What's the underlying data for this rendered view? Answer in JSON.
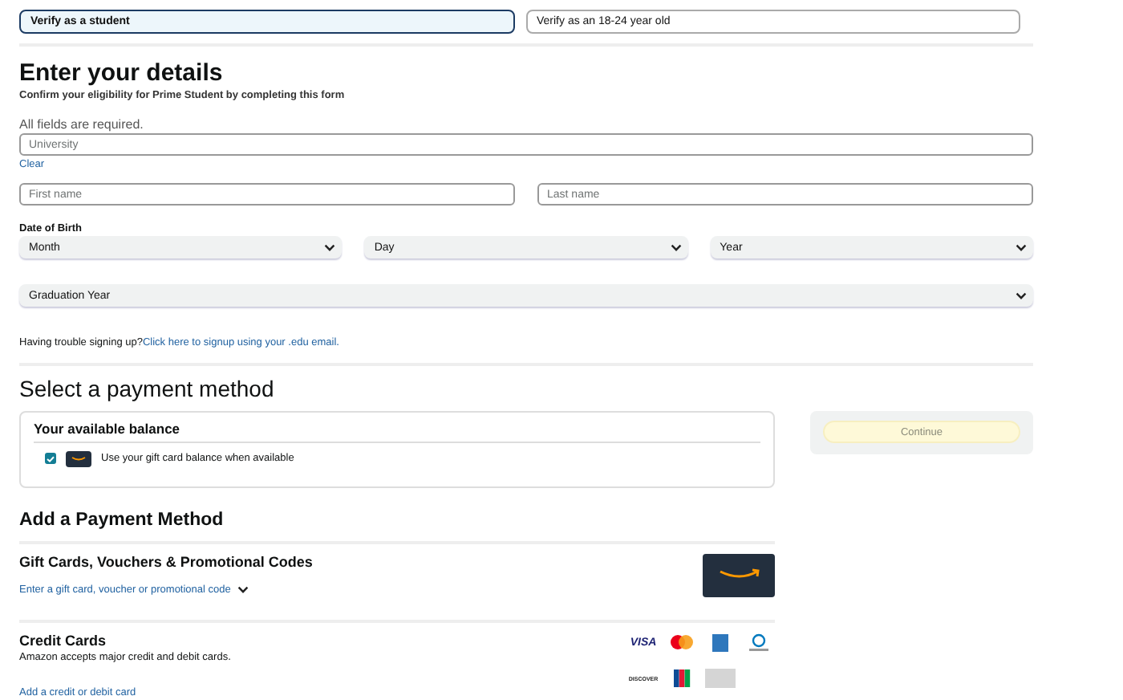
{
  "verify_tabs": [
    {
      "label": "Verify as a student",
      "selected": true
    },
    {
      "label": "Verify as an 18-24 year old",
      "selected": false
    }
  ],
  "details": {
    "title": "Enter your details",
    "subtitle": "Confirm your eligibility for Prime Student by completing this form",
    "required_note": "All fields are required.",
    "university": {
      "placeholder": "University"
    },
    "clear_link": "Clear",
    "first_name": {
      "placeholder": "First name"
    },
    "last_name": {
      "placeholder": "Last name"
    },
    "dob_label": "Date of Birth",
    "dob_selects": [
      "Month",
      "Day",
      "Year"
    ],
    "graduation_select": "Graduation Year",
    "trouble_text": "Having trouble signing up?",
    "trouble_link": "Click here to signup using your .edu email."
  },
  "payment": {
    "title": "Select a payment method",
    "balance": {
      "title": "Your available balance",
      "checked": true,
      "label": "Use your gift card balance when available"
    },
    "continue_button": {
      "label": "Continue",
      "disabled": true
    },
    "add_title": "Add a Payment Method",
    "gift": {
      "title": "Gift Cards, Vouchers & Promotional Codes",
      "link": "Enter a gift card, voucher or promotional code"
    },
    "credit": {
      "title": "Credit Cards",
      "description": "Amazon accepts major credit and debit cards.",
      "link": "Add a credit or debit card",
      "card_logos": [
        {
          "kind": "visa",
          "label": "VISA"
        },
        {
          "kind": "mastercard"
        },
        {
          "kind": "amex"
        },
        {
          "kind": "diners"
        },
        {
          "kind": "discover",
          "label": "DISCOVER"
        },
        {
          "kind": "jcb"
        },
        {
          "kind": "generic"
        }
      ]
    }
  }
}
